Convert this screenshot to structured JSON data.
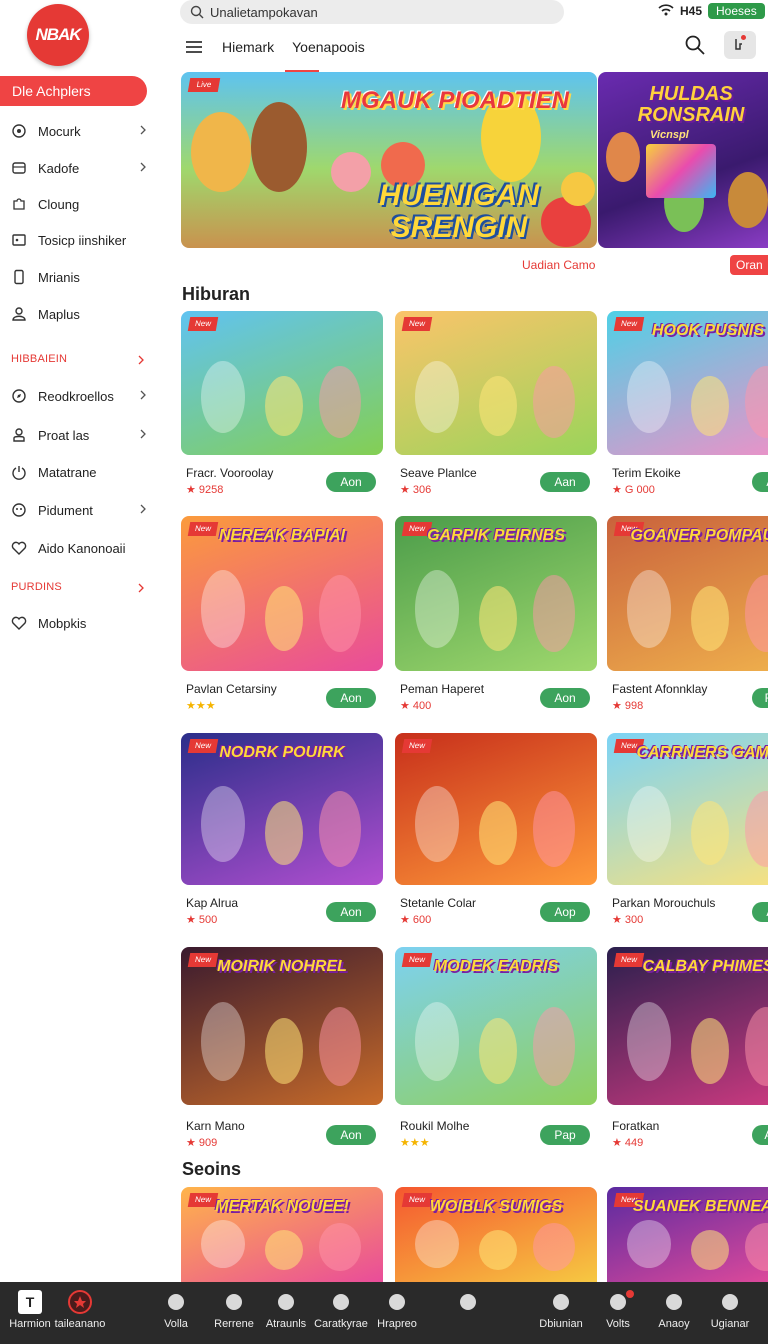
{
  "app": {
    "logo_text": "NBAK",
    "search_placeholder": "Unalietampokavan",
    "status_time": "H45",
    "status_badge": "Hoeses",
    "nav_tabs": [
      "Hiemark",
      "Yoenapoois"
    ],
    "brand_color": "#ef4444",
    "accent_green": "#3da35d"
  },
  "sidebar": {
    "active_item": "Dle Achplers",
    "items_group1": [
      {
        "label": "Mocurk",
        "icon": "clock-icon",
        "chevron": true
      },
      {
        "label": "Kadofe",
        "icon": "box-icon",
        "chevron": true
      },
      {
        "label": "Cloung",
        "icon": "puzzle-icon",
        "chevron": false
      },
      {
        "label": "Tosicp iinshiker",
        "icon": "tag-icon",
        "chevron": false
      },
      {
        "label": "Mrianis",
        "icon": "phone-icon",
        "chevron": false
      },
      {
        "label": "Maplus",
        "icon": "user-icon",
        "chevron": false
      }
    ],
    "heading2": "HIBBAIEIN",
    "items_group2": [
      {
        "label": "Reodkroellos",
        "icon": "compass-icon",
        "chevron": true
      },
      {
        "label": "Proat las",
        "icon": "profile-icon",
        "chevron": true
      },
      {
        "label": "Matatrane",
        "icon": "power-icon",
        "chevron": false
      },
      {
        "label": "Pidument",
        "icon": "smile-icon",
        "chevron": true
      },
      {
        "label": "Aido Kanonoaii",
        "icon": "heart-icon",
        "chevron": false
      }
    ],
    "heading3": "PURDINS",
    "items_group3": [
      {
        "label": "Mobpkis",
        "icon": "heart-icon",
        "chevron": false
      }
    ]
  },
  "hero": {
    "banner1_title": "MGAUK PIOADTIEN",
    "banner1_subtitle": "HUENIGAN SRENGIN",
    "banner2_title": "HULDAS RONSRAIN",
    "banner2_tag": "Vicnspl",
    "more_link": "Uadian Camo",
    "side_button": "Oran"
  },
  "sections": {
    "hiburan": "Hiburan",
    "seoins": "Seoins"
  },
  "cards": [
    {
      "title": "",
      "name": "Fracr. Vooroolay",
      "meta": "9258",
      "rating_stars": 0,
      "button": "Aon"
    },
    {
      "title": "",
      "name": "Seave Planlce",
      "meta": "306",
      "rating_stars": 0,
      "button": "Aan"
    },
    {
      "title": "HOOK PUSNIS",
      "name": "Terim Ekoike",
      "meta": "G 000",
      "rating_stars": 0,
      "button": "Aon"
    },
    {
      "title": "NEREAK BAPIAI",
      "name": "Pavlan Cetarsiny",
      "meta": "",
      "rating_stars": 3,
      "button": "Aon"
    },
    {
      "title": "GARPIK PEIRNBS",
      "name": "Peman Haperet",
      "meta": "400",
      "rating_stars": 0,
      "button": "Aon"
    },
    {
      "title": "GOANER POMPAUN",
      "name": "Fastent Afonnklay",
      "meta": "998",
      "rating_stars": 0,
      "button": "Fopr"
    },
    {
      "title": "NODRK POUIRK",
      "name": "Kap Alrua",
      "meta": "500",
      "rating_stars": 0,
      "button": "Aon"
    },
    {
      "title": "",
      "name": "Stetanle Colar",
      "meta": "600",
      "rating_stars": 0,
      "button": "Aop"
    },
    {
      "title": "CARRNERS GAME",
      "name": "Parkan Morouchuls",
      "meta": "300",
      "rating_stars": 0,
      "button": "Aon"
    },
    {
      "title": "MOIRIK NOHREL",
      "name": "Karn Mano",
      "meta": "909",
      "rating_stars": 0,
      "button": "Aon"
    },
    {
      "title": "MODEK EADRIS",
      "name": "Roukil Molhe",
      "meta": "",
      "rating_stars": 3,
      "button": "Pap"
    },
    {
      "title": "CALBAY PHIMES",
      "name": "Foratkan",
      "meta": "449",
      "rating_stars": 0,
      "button": "Aopr"
    },
    {
      "title": "MERTAK NOUEE!",
      "name": "",
      "meta": "",
      "rating_stars": 0,
      "button": ""
    },
    {
      "title": "WOIBLK SUMIGS",
      "name": "",
      "meta": "",
      "rating_stars": 0,
      "button": ""
    },
    {
      "title": "SUANEK BENNEAS",
      "name": "",
      "meta": "",
      "rating_stars": 0,
      "button": ""
    }
  ],
  "bottom_nav": [
    {
      "label": "Harmion",
      "icon": "t-square-icon"
    },
    {
      "label": "taileanano",
      "icon": "record-icon"
    },
    {
      "label": "Volla",
      "icon": "leaf-icon"
    },
    {
      "label": "Rerrene",
      "icon": "slash-icon"
    },
    {
      "label": "Atraunls",
      "icon": "plus-circle-icon"
    },
    {
      "label": "Caratkyrae",
      "icon": "shield-icon"
    },
    {
      "label": "Hrapreo",
      "icon": "flag-icon"
    },
    {
      "label": "",
      "icon": "sparkle-icon"
    },
    {
      "label": "Dbiunian",
      "icon": "moon-icon"
    },
    {
      "label": "Volts",
      "icon": "gift-icon"
    },
    {
      "label": "Anaoy",
      "icon": "grid-icon"
    },
    {
      "label": "Ugianar",
      "icon": "globe-icon"
    }
  ]
}
